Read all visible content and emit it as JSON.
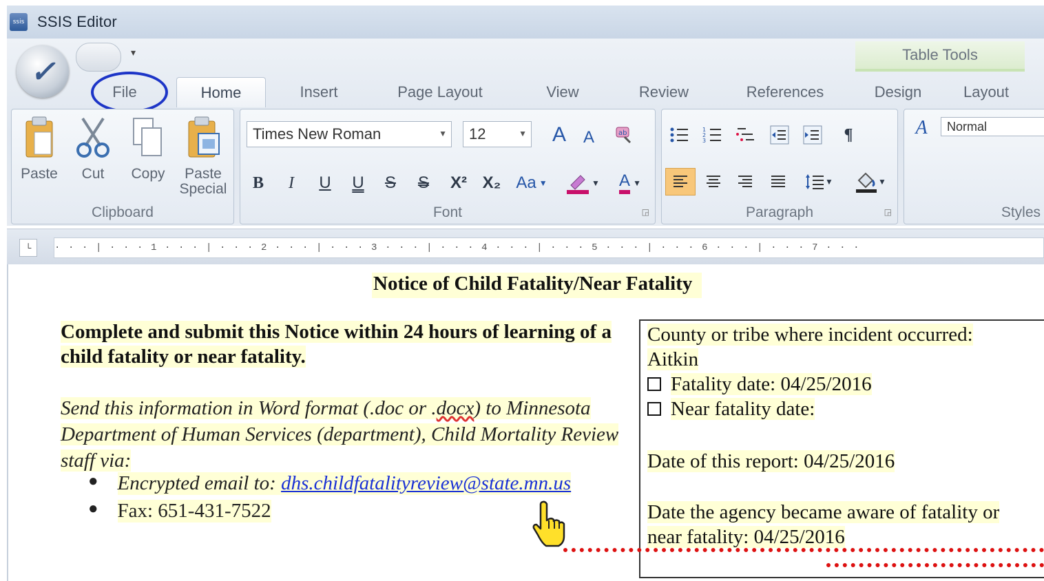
{
  "window": {
    "title": "SSIS Editor",
    "app_icon": "ssis"
  },
  "tabs": {
    "file": "File",
    "home": "Home",
    "insert": "Insert",
    "page_layout": "Page Layout",
    "view": "View",
    "review": "Review",
    "references": "References",
    "table_tools": "Table Tools",
    "design": "Design",
    "layout": "Layout"
  },
  "clipboard": {
    "paste": "Paste",
    "cut": "Cut",
    "copy": "Copy",
    "paste_special_1": "Paste",
    "paste_special_2": "Special",
    "label": "Clipboard"
  },
  "font": {
    "name": "Times New Roman",
    "size": "12",
    "grow": "A",
    "shrink": "A",
    "bold": "B",
    "italic": "I",
    "underline": "U",
    "double_underline": "U",
    "strike": "S",
    "double_strike": "S",
    "superscript": "X²",
    "subscript": "X₂",
    "change_case": "Aa",
    "font_color": "A",
    "label": "Font"
  },
  "paragraph": {
    "label": "Paragraph",
    "pilcrow": "¶"
  },
  "styles": {
    "current": "Normal",
    "label": "Styles"
  },
  "ruler": {
    "marks": "· · · | · · · 1 · · · | · · · 2 · · · | · · · 3 · · · | · · · 4 · · · | · · · 5 · · · | · · · 6 · · · | · · · 7 · · ·"
  },
  "document": {
    "title": "Notice of Child Fatality/Near Fatality",
    "lead": "Complete and submit this Notice within 24 hours of learning of a child fatality or near fatality.",
    "instr_1": "Send this information in Word format (.doc or .",
    "instr_docx": "docx",
    "instr_2": ") to Minnesota Department of Human Services (department), Child Mortality Review staff via:",
    "bullet_email_prefix": "Encrypted email to: ",
    "bullet_email": "dhs.childfatalityreview@state.mn.us",
    "bullet_fax": "Fax: 651-431-7522",
    "box": {
      "county_label": "County or tribe where incident occurred:",
      "county_value": "Aitkin",
      "fatality_date": "Fatality date:  04/25/2016",
      "near_fatality_date": "Near fatality date:",
      "report_date": "Date of this report:  04/25/2016",
      "aware_1": "Date the agency became aware of fatality or",
      "aware_2": "near fatality:  04/25/2016"
    }
  },
  "colors": {
    "highlight": "#ffffd6",
    "file_circle": "#1d35c7",
    "link": "#1a31d6",
    "red_dotted": "#d11"
  }
}
